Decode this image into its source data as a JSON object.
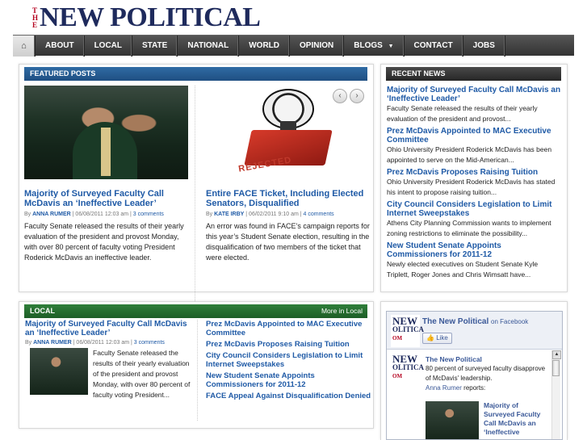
{
  "logo": {
    "the_letters": [
      "T",
      "H",
      "E"
    ],
    "name": "NEW POLITICAL"
  },
  "nav": {
    "home_icon": "home-icon",
    "items": [
      "ABOUT",
      "LOCAL",
      "STATE",
      "NATIONAL",
      "WORLD",
      "OPINION",
      "BLOGS",
      "CONTACT",
      "JOBS"
    ],
    "blogs_arrow": "▼"
  },
  "featured": {
    "header": "FEATURED POSTS",
    "posts": [
      {
        "title": "Majority of Surveyed Faculty Call McDavis an ‘Ineffective Leader’",
        "by": "By",
        "author": "ANNA RUMER",
        "date": "| 06/08/2011 12:03 am |",
        "comments": "3 comments",
        "excerpt": "Faculty Senate released the results of their yearly evaluation of the president and provost Monday, with over 80 percent of faculty voting President Roderick McDavis an ineffective leader."
      },
      {
        "title": "Entire FACE Ticket, Including Elected Senators, Disqualified",
        "by": "By",
        "author": "KATE IRBY",
        "date": "| 06/02/2011 9:10 am |",
        "comments": "4 comments",
        "excerpt": "An error was found in FACE’s campaign reports for this year’s Student Senate election, resulting in the disqualification of two members of the ticket that were elected.",
        "stamp_text": "REJECTED"
      }
    ],
    "prev_arrow": "‹",
    "next_arrow": "›"
  },
  "recent": {
    "header": "RECENT NEWS",
    "items": [
      {
        "title": "Majority of Surveyed Faculty Call McDavis an ‘Ineffective Leader’",
        "excerpt": "Faculty Senate released the results of their yearly evaluation of the president and provost..."
      },
      {
        "title": "Prez McDavis Appointed to MAC Executive Committee",
        "excerpt": "Ohio University President Roderick McDavis has been appointed to serve on the Mid-American..."
      },
      {
        "title": "Prez McDavis Proposes Raising Tuition",
        "excerpt": "Ohio University President Roderick McDavis has stated his intent to propose raising tuition..."
      },
      {
        "title": "City Council Considers Legislation to Limit Internet Sweepstakes",
        "excerpt": "Athens City Planning Commission wants to implement zoning restrictions to eliminate the possibility..."
      },
      {
        "title": "New Student Senate Appoints Commissioners for 2011-12",
        "excerpt": "Newly elected executives on Student Senate Kyle Triplett, Roger Jones and Chris Wimsatt have..."
      }
    ]
  },
  "local": {
    "header": "LOCAL",
    "more": "More in Local",
    "lead": {
      "title": "Majority of Surveyed Faculty Call McDavis an ‘Ineffective Leader’",
      "by": "By",
      "author": "ANNA RUMER",
      "date": "| 06/08/2011 12:03 am |",
      "comments": "3 comments",
      "excerpt": "Faculty Senate released the results of their yearly evaluation of the president and provost Monday, with over 80 percent of faculty voting President..."
    },
    "links": [
      "Prez McDavis Appointed to MAC Executive Committee",
      "Prez McDavis Proposes Raising Tuition",
      "City Council Considers Legislation to Limit Internet Sweepstakes",
      "New Student Senate Appoints Commissioners for 2011-12",
      "FACE Appeal Against Disqualification Denied"
    ]
  },
  "facebook": {
    "page_name": "The New Political",
    "on_facebook": "on Facebook",
    "like": "Like",
    "logo_lines": [
      "NEW",
      "OLITICA",
      "OM"
    ],
    "post": {
      "name": "The New Political",
      "text": "80 percent of surveyed faculty disapprove of McDavis' leadership.",
      "reporter": "Anna Rumer",
      "reports": "reports:",
      "link_title": "Majority of Surveyed Faculty Call McDavis an ‘Ineffective"
    },
    "scroll_up": "▲"
  }
}
